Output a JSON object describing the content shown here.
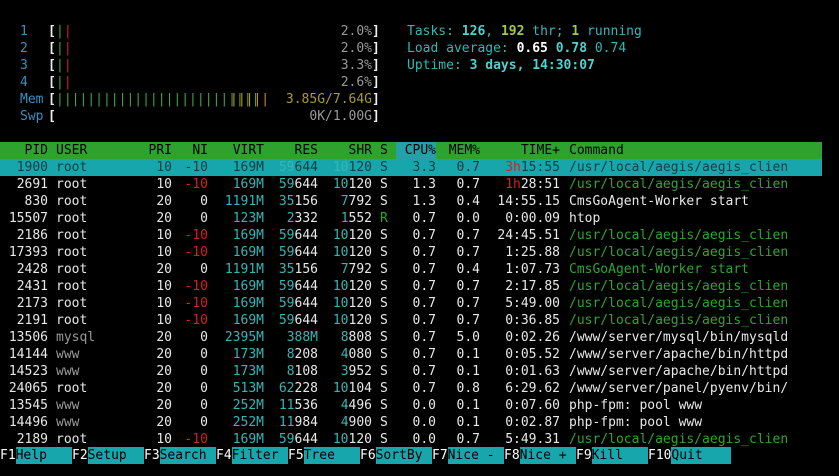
{
  "cpus": [
    {
      "num": "1",
      "pct": "2.0%",
      "bars": "||"
    },
    {
      "num": "2",
      "pct": "2.0%",
      "bars": "||"
    },
    {
      "num": "3",
      "pct": "3.3%",
      "bars": "||"
    },
    {
      "num": "4",
      "pct": "2.6%",
      "bars": "||"
    }
  ],
  "mem": {
    "label": "Mem",
    "green": "||||||||||||||||||||||||||",
    "orange": "|||||",
    "value": "3.85G/7.64G"
  },
  "swp": {
    "label": "Swp",
    "value": "0K/1.00G"
  },
  "tasks": {
    "label": "Tasks:",
    "count": "126",
    "sep": ",",
    "thr": "192",
    "thr_label": "thr;",
    "running": "1",
    "running_label": "running"
  },
  "load": {
    "label": "Load average:",
    "l1": "0.65",
    "l5": "0.78",
    "l15": "0.74"
  },
  "uptime": {
    "label": "Uptime:",
    "value": "3 days, 14:30:07"
  },
  "headers": {
    "pid": "PID",
    "user": "USER",
    "pri": "PRI",
    "ni": "NI",
    "virt": "VIRT",
    "res": "RES",
    "shr": "SHR",
    "s": "S",
    "cpu": "CPU%",
    "mem": "MEM%",
    "time": "TIME+",
    "cmd": "Command"
  },
  "processes": [
    {
      "pid": "1900",
      "user": "root",
      "pri": "10",
      "ni": "-10",
      "virt": "169M",
      "res": "59644",
      "shr": "10120",
      "s": "S",
      "cpu": "3.3",
      "mem": "0.7",
      "time": "3h15:55",
      "cmd": "/usr/local/aegis/aegis_clien"
    },
    {
      "pid": "2691",
      "user": "root",
      "pri": "10",
      "ni": "-10",
      "virt": "169M",
      "res": "59644",
      "shr": "10120",
      "s": "S",
      "cpu": "1.3",
      "mem": "0.7",
      "time": "1h28:51",
      "cmd": "/usr/local/aegis/aegis_clien"
    },
    {
      "pid": "830",
      "user": "root",
      "pri": "20",
      "ni": "0",
      "virt": "1191M",
      "res": "35156",
      "shr": "7792",
      "s": "S",
      "cpu": "1.3",
      "mem": "0.4",
      "time": "14:55.15",
      "cmd": "CmsGoAgent-Worker start"
    },
    {
      "pid": "15507",
      "user": "root",
      "pri": "20",
      "ni": "0",
      "virt": "123M",
      "res": "2332",
      "shr": "1552",
      "s": "R",
      "cpu": "0.7",
      "mem": "0.0",
      "time": "0:00.09",
      "cmd": "htop"
    },
    {
      "pid": "2186",
      "user": "root",
      "pri": "10",
      "ni": "-10",
      "virt": "169M",
      "res": "59644",
      "shr": "10120",
      "s": "S",
      "cpu": "0.7",
      "mem": "0.7",
      "time": "24:45.51",
      "cmd": "/usr/local/aegis/aegis_clien"
    },
    {
      "pid": "17393",
      "user": "root",
      "pri": "10",
      "ni": "-10",
      "virt": "169M",
      "res": "59644",
      "shr": "10120",
      "s": "S",
      "cpu": "0.7",
      "mem": "0.7",
      "time": "1:25.88",
      "cmd": "/usr/local/aegis/aegis_clien"
    },
    {
      "pid": "2428",
      "user": "root",
      "pri": "20",
      "ni": "0",
      "virt": "1191M",
      "res": "35156",
      "shr": "7792",
      "s": "S",
      "cpu": "0.7",
      "mem": "0.4",
      "time": "1:07.73",
      "cmd": "CmsGoAgent-Worker start"
    },
    {
      "pid": "2431",
      "user": "root",
      "pri": "10",
      "ni": "-10",
      "virt": "169M",
      "res": "59644",
      "shr": "10120",
      "s": "S",
      "cpu": "0.7",
      "mem": "0.7",
      "time": "2:17.85",
      "cmd": "/usr/local/aegis/aegis_clien"
    },
    {
      "pid": "2173",
      "user": "root",
      "pri": "10",
      "ni": "-10",
      "virt": "169M",
      "res": "59644",
      "shr": "10120",
      "s": "S",
      "cpu": "0.7",
      "mem": "0.7",
      "time": "5:49.00",
      "cmd": "/usr/local/aegis/aegis_clien"
    },
    {
      "pid": "2191",
      "user": "root",
      "pri": "10",
      "ni": "-10",
      "virt": "169M",
      "res": "59644",
      "shr": "10120",
      "s": "S",
      "cpu": "0.7",
      "mem": "0.7",
      "time": "0:36.85",
      "cmd": "/usr/local/aegis/aegis_clien"
    },
    {
      "pid": "13506",
      "user": "mysql",
      "pri": "20",
      "ni": "0",
      "virt": "2395M",
      "res": "388M",
      "shr": "8808",
      "s": "S",
      "cpu": "0.7",
      "mem": "5.0",
      "time": "0:02.26",
      "cmd": "/www/server/mysql/bin/mysqld"
    },
    {
      "pid": "14144",
      "user": "www",
      "pri": "20",
      "ni": "0",
      "virt": "173M",
      "res": "8208",
      "shr": "4080",
      "s": "S",
      "cpu": "0.7",
      "mem": "0.1",
      "time": "0:05.52",
      "cmd": "/www/server/apache/bin/httpd"
    },
    {
      "pid": "14523",
      "user": "www",
      "pri": "20",
      "ni": "0",
      "virt": "173M",
      "res": "8108",
      "shr": "3952",
      "s": "S",
      "cpu": "0.7",
      "mem": "0.1",
      "time": "0:01.63",
      "cmd": "/www/server/apache/bin/httpd"
    },
    {
      "pid": "24065",
      "user": "root",
      "pri": "20",
      "ni": "0",
      "virt": "513M",
      "res": "62228",
      "shr": "10104",
      "s": "S",
      "cpu": "0.7",
      "mem": "0.8",
      "time": "6:29.62",
      "cmd": "/www/server/panel/pyenv/bin/"
    },
    {
      "pid": "13545",
      "user": "www",
      "pri": "20",
      "ni": "0",
      "virt": "252M",
      "res": "11536",
      "shr": "4496",
      "s": "S",
      "cpu": "0.0",
      "mem": "0.1",
      "time": "0:07.60",
      "cmd": "php-fpm: pool www"
    },
    {
      "pid": "14496",
      "user": "www",
      "pri": "20",
      "ni": "0",
      "virt": "252M",
      "res": "11984",
      "shr": "4900",
      "s": "S",
      "cpu": "0.0",
      "mem": "0.1",
      "time": "0:02.87",
      "cmd": "php-fpm: pool www"
    },
    {
      "pid": "2189",
      "user": "root",
      "pri": "10",
      "ni": "-10",
      "virt": "169M",
      "res": "59644",
      "shr": "10120",
      "s": "S",
      "cpu": "0.0",
      "mem": "0.7",
      "time": "5:49.31",
      "cmd": "/usr/local/aegis/aegis_clien"
    }
  ],
  "footer": [
    {
      "key": "F1",
      "label": "Help"
    },
    {
      "key": "F2",
      "label": "Setup"
    },
    {
      "key": "F3",
      "label": "Search"
    },
    {
      "key": "F4",
      "label": "Filter"
    },
    {
      "key": "F5",
      "label": "Tree"
    },
    {
      "key": "F6",
      "label": "SortBy"
    },
    {
      "key": "F7",
      "label": "Nice -"
    },
    {
      "key": "F8",
      "label": "Nice +"
    },
    {
      "key": "F9",
      "label": "Kill"
    },
    {
      "key": "F10",
      "label": "Quit"
    }
  ],
  "colors": {
    "header_bg": "#2ea12e",
    "selection_bg": "#18a6ad",
    "accent_cyan": "#35b6b6"
  }
}
